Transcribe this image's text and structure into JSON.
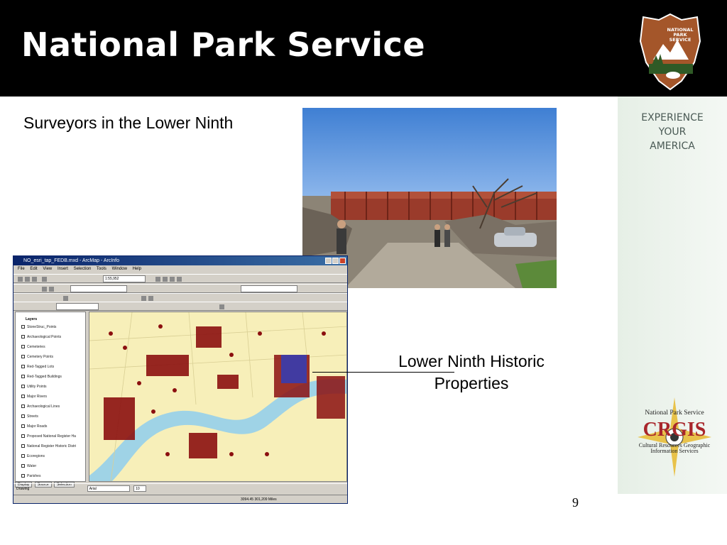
{
  "header": {
    "title": "National Park Service"
  },
  "logo": {
    "nps_text": "NATIONAL PARK SERVICE",
    "brand_color": "#a4562a"
  },
  "sidebar": {
    "tagline_lines": [
      "EXPERIENCE",
      "YOUR",
      "AMERICA"
    ],
    "crgis_top": "National Park Service",
    "crgis_name": "CRGIS",
    "crgis_sub1": "Cultural Resources Geographic",
    "crgis_sub2": "Information Services"
  },
  "slide": {
    "heading": "Surveyors in the Lower Ninth",
    "callout_line1": "Lower Ninth Historic",
    "callout_line2": "Properties",
    "page_number": "9"
  },
  "arcmap": {
    "window_title": "NO_esri_tap_FEDB.mxd - ArcMap - ArcInfo",
    "menu": [
      "File",
      "Edit",
      "View",
      "Insert",
      "Selection",
      "Tools",
      "Window",
      "Help"
    ],
    "layers_title": "Layers",
    "layers": [
      "StoneStruc_Points",
      "Archaeological Points",
      "Cemeteries",
      "Cemetery Points",
      "Red-Tagged Lots",
      "Red-Tagged Buildings",
      "Utility Points",
      "Major Rivers",
      "Archaeological Lines",
      "Streets",
      "Major Roads",
      "Proposed National Register Ha",
      "National Register Historic Distri",
      "Ecoregions",
      "Water",
      "Parishes"
    ],
    "tabs": [
      "Display",
      "Source",
      "Selection"
    ],
    "drawing_label": "Drawing",
    "font_value": "Arial",
    "font_size": "10",
    "scale_value": "1:55,952",
    "status_text": "3094.45  301,209 Miles",
    "colors": {
      "map_land": "#f7efb9",
      "river": "#9fd3e6",
      "points": "#8b0f0f",
      "highlight": "#2a3fbf"
    }
  },
  "photo": {
    "sky_color": "#5a92d8",
    "barge_color": "#9a3b2b"
  }
}
